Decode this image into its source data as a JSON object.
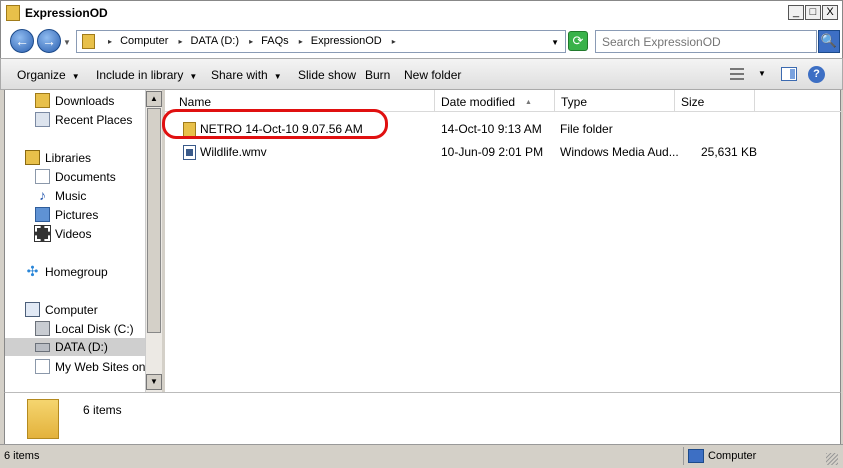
{
  "window": {
    "title": "ExpressionOD",
    "controls": {
      "minimize": "_",
      "maximize": "□",
      "close": "X"
    }
  },
  "address": {
    "back_icon": "←",
    "forward_icon": "→",
    "breadcrumbs": [
      "Computer",
      "DATA (D:)",
      "FAQs",
      "ExpressionOD"
    ],
    "refresh_icon": "⟳"
  },
  "search": {
    "placeholder": "Search ExpressionOD",
    "icon": "🔍"
  },
  "toolbar": {
    "organize": "Organize",
    "include_in_library": "Include in library",
    "share_with": "Share with",
    "slide_show": "Slide show",
    "burn": "Burn",
    "new_folder": "New folder",
    "help": "?"
  },
  "nav": {
    "items": [
      {
        "label": "Downloads",
        "icon": "downloads-folder-icon"
      },
      {
        "label": "Recent Places",
        "icon": "recent-places-icon"
      },
      {
        "label": "Libraries",
        "icon": "libraries-icon"
      },
      {
        "label": "Documents",
        "icon": "documents-icon"
      },
      {
        "label": "Music",
        "icon": "music-icon"
      },
      {
        "label": "Pictures",
        "icon": "pictures-icon"
      },
      {
        "label": "Videos",
        "icon": "videos-icon"
      },
      {
        "label": "Homegroup",
        "icon": "homegroup-icon"
      },
      {
        "label": "Computer",
        "icon": "computer-icon"
      },
      {
        "label": "Local Disk (C:)",
        "icon": "local-disk-icon"
      },
      {
        "label": "DATA (D:)",
        "icon": "drive-icon"
      },
      {
        "label": "My Web Sites on M",
        "icon": "web-sites-icon"
      }
    ]
  },
  "columns": {
    "name": "Name",
    "date_modified": "Date modified",
    "type": "Type",
    "size": "Size"
  },
  "files": [
    {
      "name": "NETRO 14-Oct-10 9.07.56 AM",
      "date": "14-Oct-10 9:13 AM",
      "type": "File folder",
      "size": "",
      "icon": "folder-icon"
    },
    {
      "name": "Wildlife.wmv",
      "date": "10-Jun-09 2:01 PM",
      "type": "Windows Media Aud...",
      "size": "25,631 KB",
      "icon": "wmv-file-icon"
    }
  ],
  "details": {
    "count": "6 items"
  },
  "status": {
    "left": "6 items",
    "right": "Computer"
  },
  "colors": {
    "highlight": "#e01010",
    "selected_nav": "#cfcfcf"
  }
}
